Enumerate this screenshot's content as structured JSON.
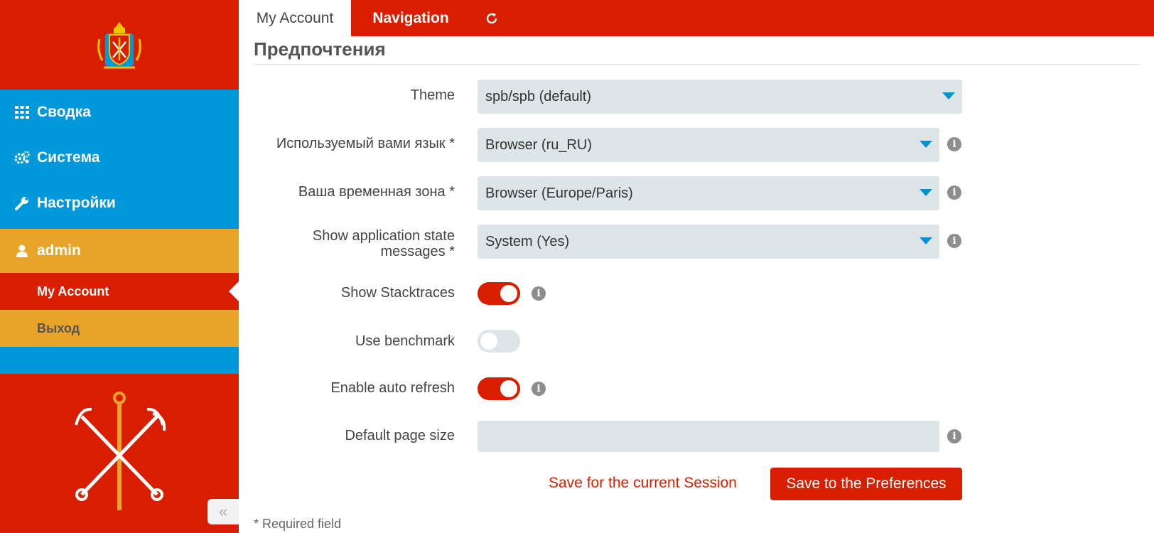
{
  "sidebar": {
    "items": [
      {
        "label": "Сводка",
        "icon": "dashboard-grid-icon"
      },
      {
        "label": "Система",
        "icon": "gears-icon"
      },
      {
        "label": "Настройки",
        "icon": "wrench-icon"
      },
      {
        "label": "admin",
        "icon": "user-icon"
      }
    ],
    "subitems": [
      {
        "label": "My Account",
        "active": true
      },
      {
        "label": "Выход",
        "active": false
      }
    ],
    "collapse_glyph": "«"
  },
  "tabs": [
    {
      "label": "My Account",
      "active": true
    },
    {
      "label": "Navigation",
      "active": false
    },
    {
      "label": "↻",
      "icon": "refresh-icon"
    }
  ],
  "section": {
    "title": "Предпочтения"
  },
  "form": {
    "theme": {
      "label": "Theme",
      "value": "spb/spb (default)"
    },
    "language": {
      "label": "Используемый вами язык *",
      "value": "Browser (ru_RU)"
    },
    "timezone": {
      "label": "Ваша временная зона *",
      "value": "Browser (Europe/Paris)"
    },
    "state_messages": {
      "label_line1": "Show application state",
      "label_line2": "messages *",
      "value": "System (Yes)"
    },
    "stacktraces": {
      "label": "Show Stacktraces",
      "on": true
    },
    "benchmark": {
      "label": "Use benchmark",
      "on": false
    },
    "auto_refresh": {
      "label": "Enable auto refresh",
      "on": true
    },
    "page_size": {
      "label": "Default page size",
      "value": ""
    },
    "info_glyph": "i"
  },
  "actions": {
    "save_session": "Save for the current Session",
    "save_prefs": "Save to the Preferences"
  },
  "footer": {
    "required_note": "* Required field"
  },
  "colors": {
    "primary_red": "#d91e00",
    "nav_blue": "#0098d8",
    "accent_orange": "#e8a428",
    "input_bg": "#dde5e8",
    "caret_blue": "#0a8fcf"
  }
}
